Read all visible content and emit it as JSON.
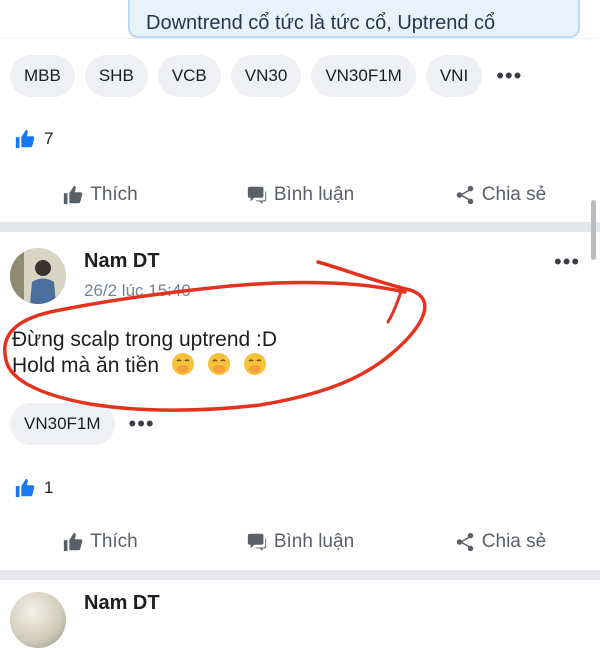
{
  "previous_post": {
    "quote_text": "Downtrend cổ tức là tức cổ, Uptrend cổ",
    "tags": [
      "MBB",
      "SHB",
      "VCB",
      "VN30",
      "VN30F1M",
      "VNI"
    ],
    "more_label": "•••",
    "like_count": "7"
  },
  "actions": {
    "like": "Thích",
    "comment": "Bình luận",
    "share": "Chia sẻ"
  },
  "post": {
    "author": "Nam DT",
    "timestamp": "26/2 lúc 15:40",
    "line1": "Đừng scalp trong uptrend :D",
    "line2": "Hold mà ăn tiền",
    "emoji_count": 3,
    "tags": [
      "VN30F1M"
    ],
    "more_label": "•••",
    "like_count": "1"
  },
  "next_post": {
    "author_partial": "Nam DT"
  },
  "colors": {
    "accent_blue": "#1877f2",
    "annotation_red": "#e5321f"
  }
}
